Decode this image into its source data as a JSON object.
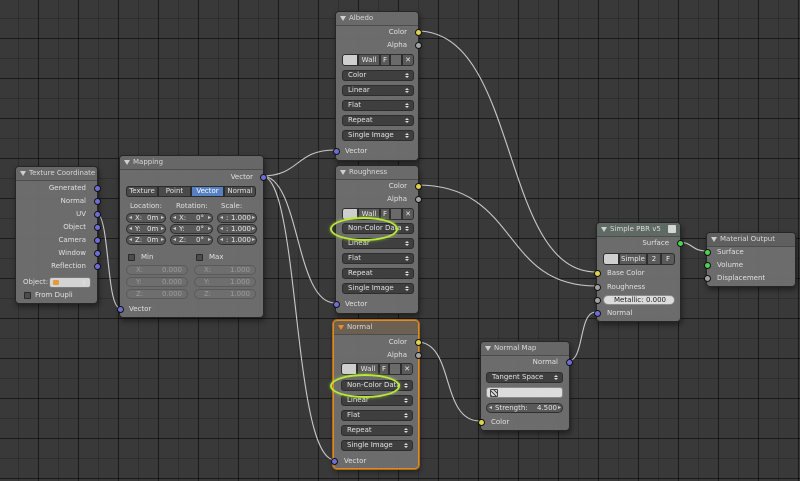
{
  "colors": {
    "color_socket": "#ddd24a",
    "float_socket": "#a3a3a3",
    "vector_socket": "#6d6dd8",
    "shader_socket": "#4fcf52",
    "selection_outline": "#d88d2a",
    "highlight_circle": "#b8e83a",
    "toggle_active": "#5680c2"
  },
  "tex_coord": {
    "title": "Texture Coordinate",
    "outputs": [
      "Generated",
      "Normal",
      "UV",
      "Object",
      "Camera",
      "Window",
      "Reflection"
    ],
    "object_label": "Object:",
    "from_dupli": "From Dupli"
  },
  "mapping": {
    "title": "Mapping",
    "output": "Vector",
    "input": "Vector",
    "modes": [
      "Texture",
      "Point",
      "Vector",
      "Normal"
    ],
    "active_mode": "Vector",
    "headers": [
      "Location:",
      "Rotation:",
      "Scale:"
    ],
    "rows": [
      {
        "loc": "X:",
        "loc_v": "0m",
        "rot": "X:",
        "rot_v": "0°",
        "scale": ":",
        "scale_v": "1.000"
      },
      {
        "loc": "Y:",
        "loc_v": "0m",
        "rot": "Y:",
        "rot_v": "0°",
        "scale": ":",
        "scale_v": "1.000"
      },
      {
        "loc": "Z:",
        "loc_v": "0m",
        "rot": "Z:",
        "rot_v": "0°",
        "scale": ":",
        "scale_v": "1.000"
      }
    ],
    "min_label": "Min",
    "max_label": "Max",
    "min_rows": [
      {
        "k": "X:",
        "v": "0.000"
      },
      {
        "k": "Y:",
        "v": "0.000"
      },
      {
        "k": "Z:",
        "v": "0.000"
      }
    ],
    "max_rows": [
      {
        "k": "X:",
        "v": "1.000"
      },
      {
        "k": "Y:",
        "v": "1.000"
      },
      {
        "k": "Z:",
        "v": "1.000"
      }
    ]
  },
  "albedo": {
    "title": "Albedo",
    "outputs": [
      "Color",
      "Alpha"
    ],
    "image": "Wall",
    "fake": "F",
    "color_space": "Color",
    "interpolation": "Linear",
    "projection": "Flat",
    "extension": "Repeat",
    "source": "Single Image",
    "input": "Vector"
  },
  "roughness": {
    "title": "Roughness",
    "outputs": [
      "Color",
      "Alpha"
    ],
    "image": "Wall",
    "fake": "F",
    "color_space": "Non-Color Data",
    "interpolation": "Linear",
    "projection": "Flat",
    "extension": "Repeat",
    "source": "Single Image",
    "input": "Vector"
  },
  "normal": {
    "title": "Normal",
    "outputs": [
      "Color",
      "Alpha"
    ],
    "image": "Wall",
    "fake": "F",
    "color_space": "Non-Color Data",
    "interpolation": "Linear",
    "projection": "Flat",
    "extension": "Repeat",
    "source": "Single Image",
    "input": "Vector"
  },
  "normal_map": {
    "title": "Normal Map",
    "output": "Normal",
    "space": "Tangent Space",
    "strength_label": "Strength:",
    "strength": "4.500",
    "input": "Color"
  },
  "pbr": {
    "title": "Simple PBR v5",
    "output": "Surface",
    "group_name": "Simple",
    "users": "2",
    "fake": "F",
    "inputs": [
      "Base Color",
      "Roughness"
    ],
    "metallic_label": "Metallic:",
    "metallic": "0.000",
    "normal_input": "Normal"
  },
  "material_output": {
    "title": "Material Output",
    "inputs": [
      "Surface",
      "Volume",
      "Displacement"
    ]
  }
}
